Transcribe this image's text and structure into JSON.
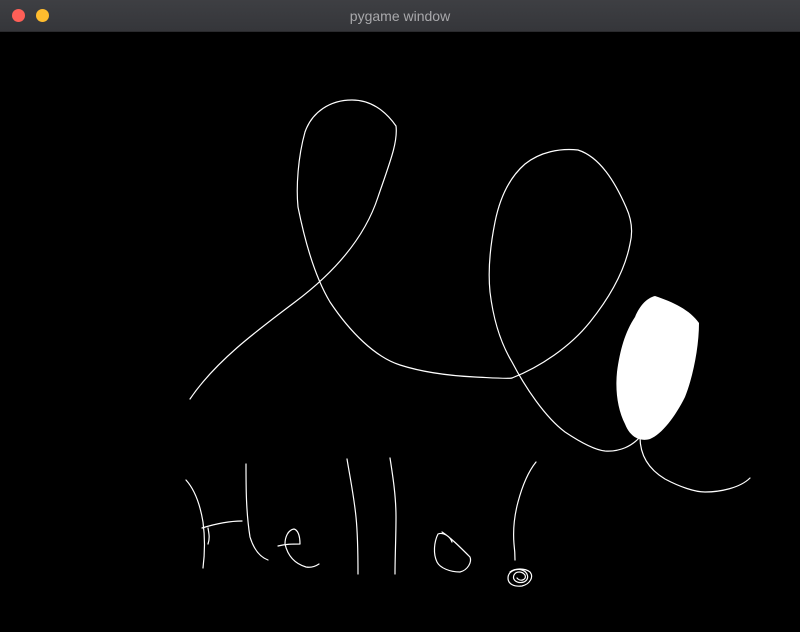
{
  "window": {
    "title": "pygame window",
    "close_color": "#fe5f57",
    "minimize_color": "#febc2e"
  },
  "canvas": {
    "background_color": "#000000",
    "stroke_color": "#ffffff"
  }
}
